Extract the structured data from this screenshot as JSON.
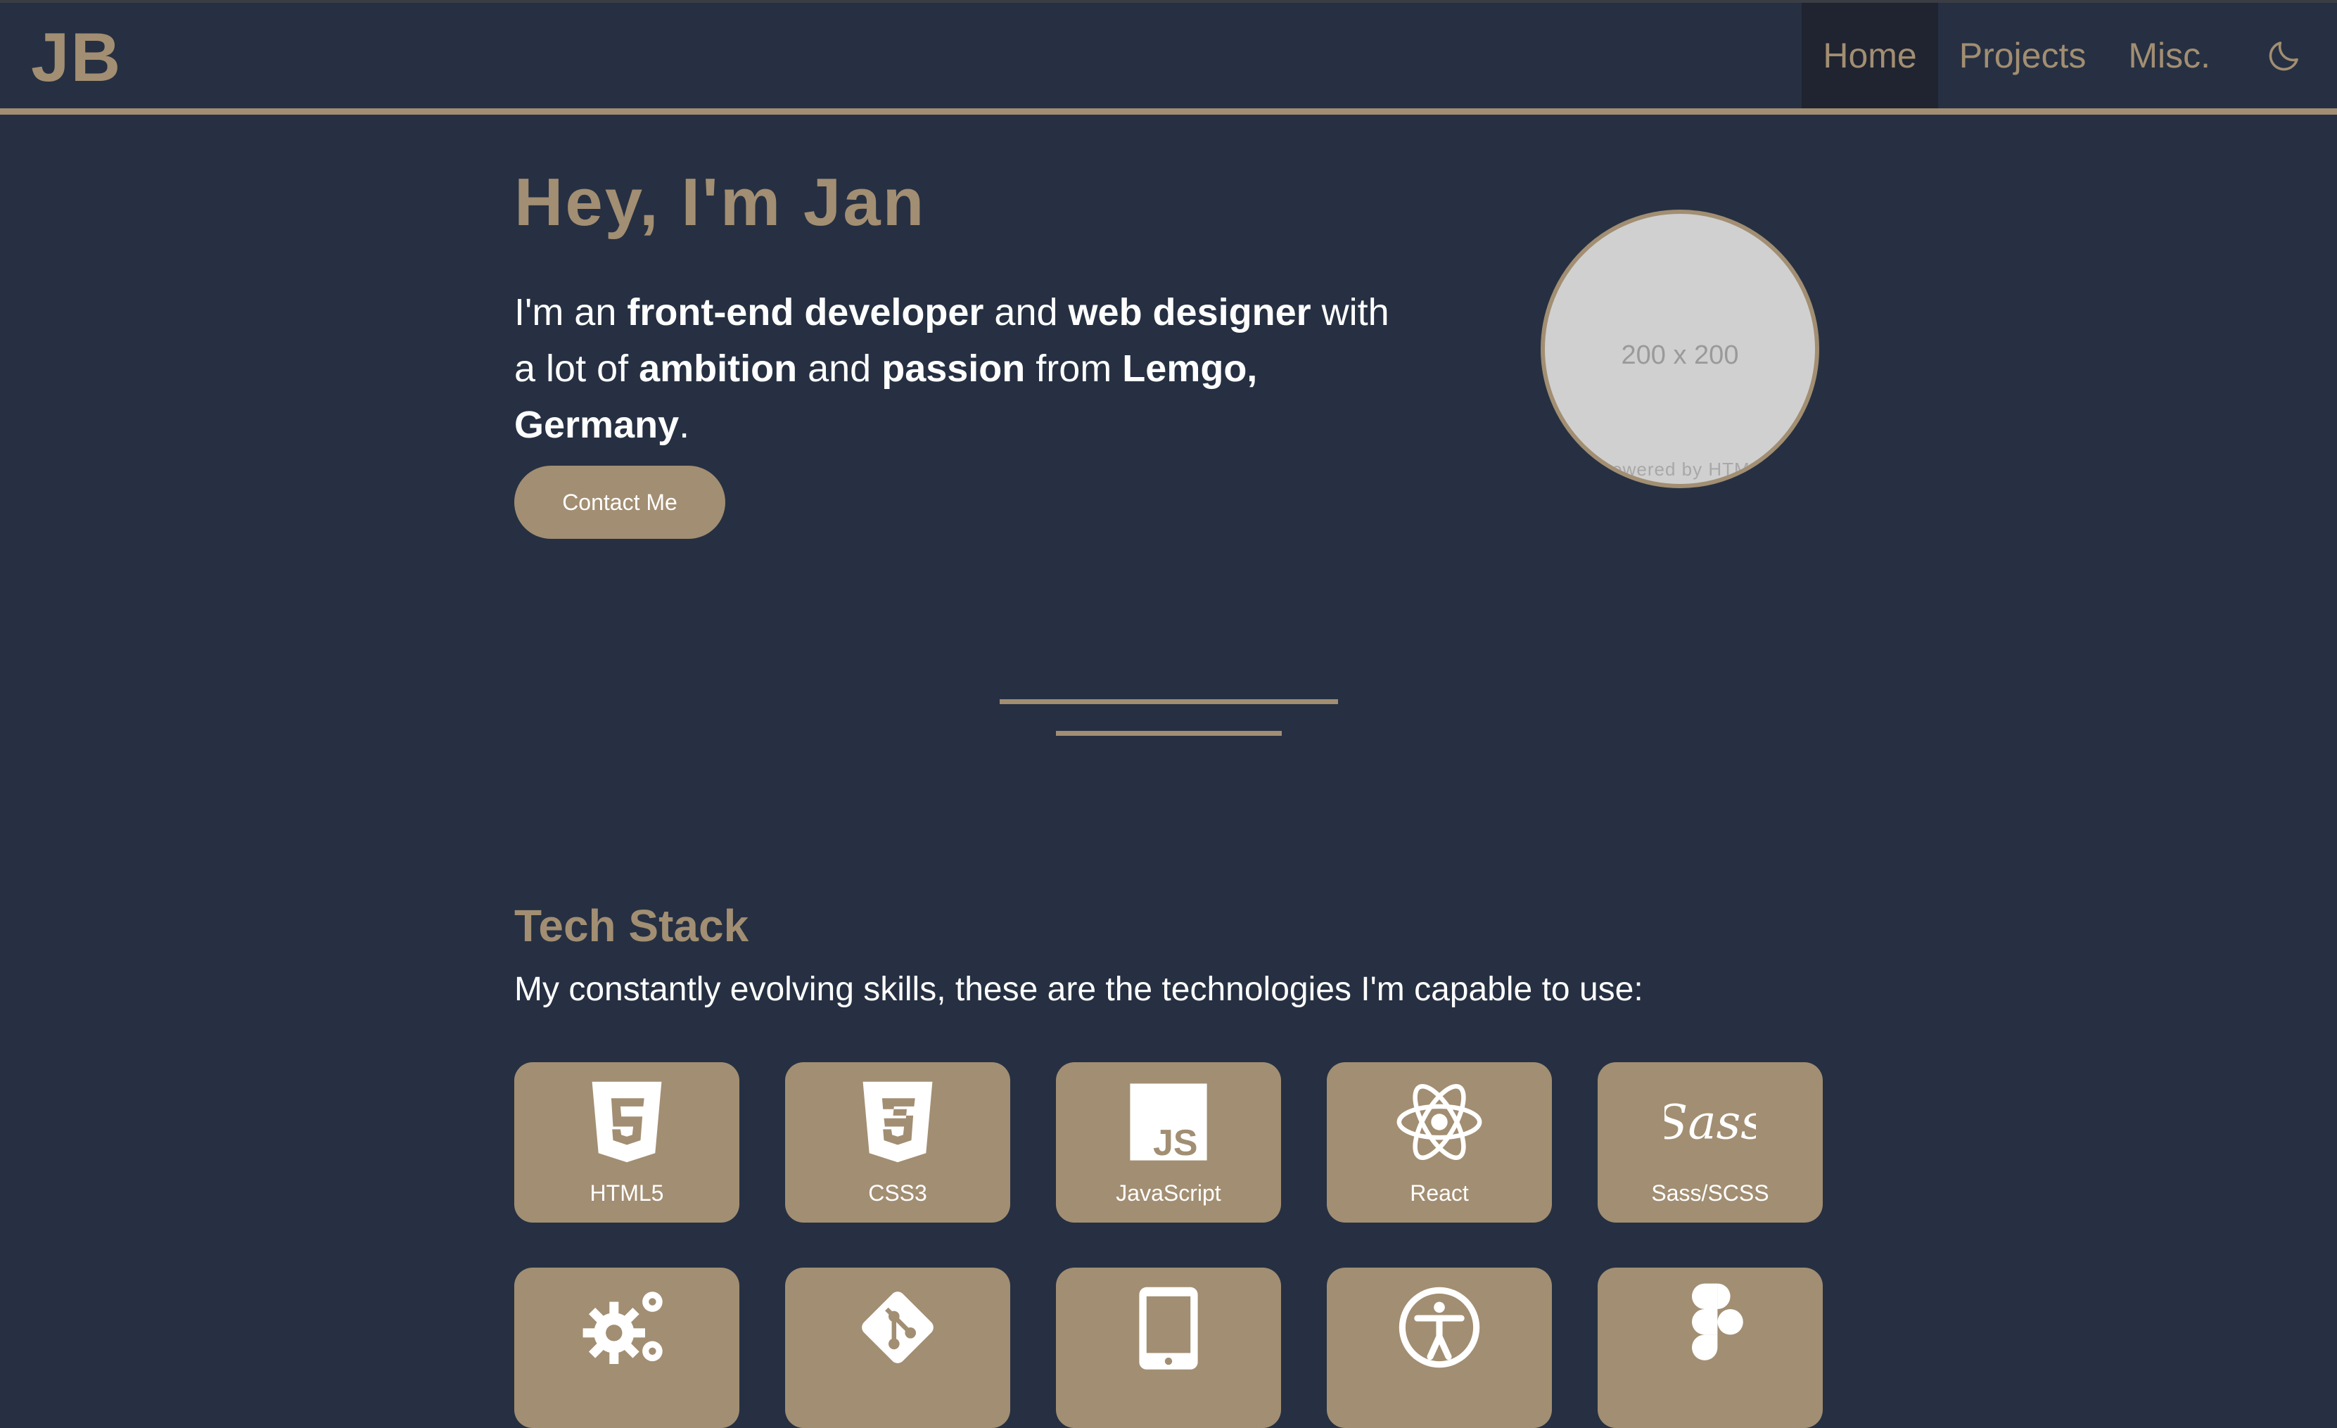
{
  "header": {
    "logo": "JB",
    "nav": [
      {
        "label": "Home",
        "active": true
      },
      {
        "label": "Projects",
        "active": false
      },
      {
        "label": "Misc.",
        "active": false
      }
    ],
    "theme_toggle_icon": "moon-icon"
  },
  "hero": {
    "title": "Hey, I'm Jan",
    "intro": {
      "t1": "I'm an ",
      "b1": "front-end developer",
      "t2": " and ",
      "b2": "web designer",
      "t3": " with a lot of ",
      "b3": "ambition",
      "t4": " and ",
      "b4": "passion",
      "t5": " from ",
      "b5": "Lemgo, Germany",
      "t6": "."
    },
    "contact_label": "Contact Me",
    "avatar_placeholder": "200 x 200",
    "avatar_powered": "Powered by HTML"
  },
  "tech": {
    "title": "Tech Stack",
    "subtitle": "My constantly evolving skills, these are the technologies I'm capable to use:",
    "items": [
      {
        "label": "HTML5",
        "icon": "html5-icon"
      },
      {
        "label": "CSS3",
        "icon": "css3-icon"
      },
      {
        "label": "JavaScript",
        "icon": "javascript-icon"
      },
      {
        "label": "React",
        "icon": "react-icon"
      },
      {
        "label": "Sass/SCSS",
        "icon": "sass-icon"
      },
      {
        "label": "",
        "icon": "gears-icon"
      },
      {
        "label": "",
        "icon": "git-icon"
      },
      {
        "label": "",
        "icon": "tablet-icon"
      },
      {
        "label": "",
        "icon": "accessibility-icon"
      },
      {
        "label": "",
        "icon": "figma-icon"
      }
    ]
  },
  "colors": {
    "background": "#263042",
    "accent": "#a28e72",
    "nav_active": "#1f2430",
    "text": "#ffffff"
  }
}
